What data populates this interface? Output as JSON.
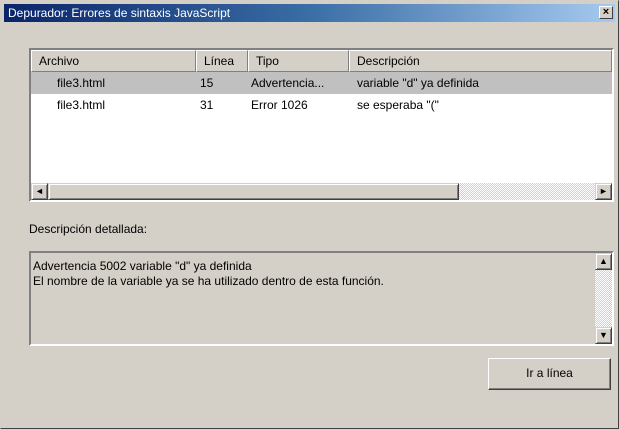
{
  "window": {
    "title": "Depurador: Errores de sintaxis JavaScript",
    "close_glyph": "×"
  },
  "list": {
    "columns": [
      "Archivo",
      "Línea",
      "Tipo",
      "Descripción"
    ],
    "rows": [
      [
        "file3.html",
        "15",
        "Advertencia...",
        "variable \"d\" ya definida"
      ],
      [
        "file3.html",
        "31",
        "Error 1026",
        "se esperaba \"(\""
      ]
    ],
    "selected_row": 0
  },
  "detail": {
    "label": "Descripción detallada:",
    "line1": "Advertencia 5002 variable \"d\" ya definida",
    "line2": "El nombre de la variable ya se ha utilizado dentro de esta función."
  },
  "buttons": {
    "goto_line": "Ir a línea"
  },
  "icons": {
    "scroll_left": "◄",
    "scroll_right": "►",
    "scroll_up": "▲",
    "scroll_down": "▼"
  }
}
